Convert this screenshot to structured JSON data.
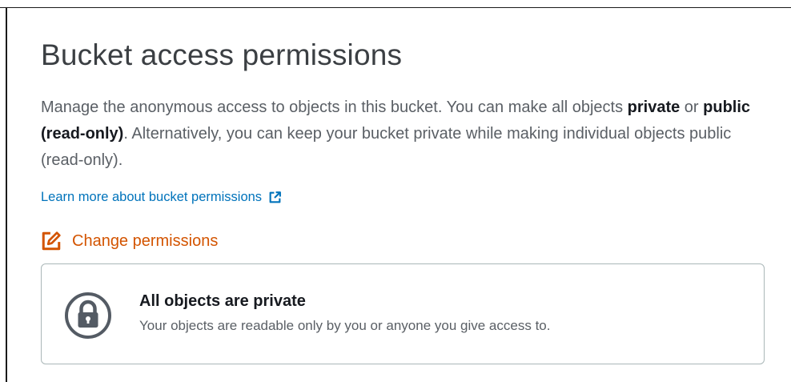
{
  "section": {
    "title": "Bucket access permissions",
    "description": {
      "part1": "Manage the anonymous access to objects in this bucket. You can make all objects ",
      "private_bold": "private",
      "or": " or ",
      "public_bold": "public (read-only)",
      "part2": ". Alternatively, you can keep your bucket private while making individual objects public (read-only)."
    },
    "learn_more_link": "Learn more about bucket permissions",
    "change_permissions_label": "Change permissions"
  },
  "status": {
    "title": "All objects are private",
    "subtitle": "Your objects are readable only by you or anyone you give access to."
  },
  "icons": {
    "external_link": "external-link-icon",
    "edit": "edit-icon",
    "lock": "lock-icon"
  },
  "colors": {
    "link": "#0073bb",
    "action": "#d35400",
    "heading": "#3b3f43",
    "body_text": "#5a5f65",
    "border": "#aab7b8"
  }
}
